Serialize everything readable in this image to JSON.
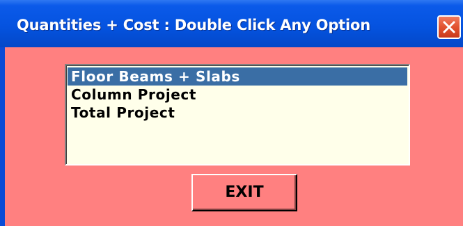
{
  "window": {
    "title": "Quantities + Cost : Double Click Any Option",
    "close_icon": "close-icon"
  },
  "options_list": {
    "items": [
      {
        "label": "Floor Beams + Slabs",
        "selected": true
      },
      {
        "label": "Column Project",
        "selected": false
      },
      {
        "label": "Total Project",
        "selected": false
      }
    ]
  },
  "buttons": {
    "exit_label": "EXIT"
  },
  "colors": {
    "titlebar": "#0553e0",
    "client_background": "#ff8080",
    "listbox_background": "#ffffea",
    "selection": "#3a6ea5",
    "close_button": "#e2522f"
  }
}
